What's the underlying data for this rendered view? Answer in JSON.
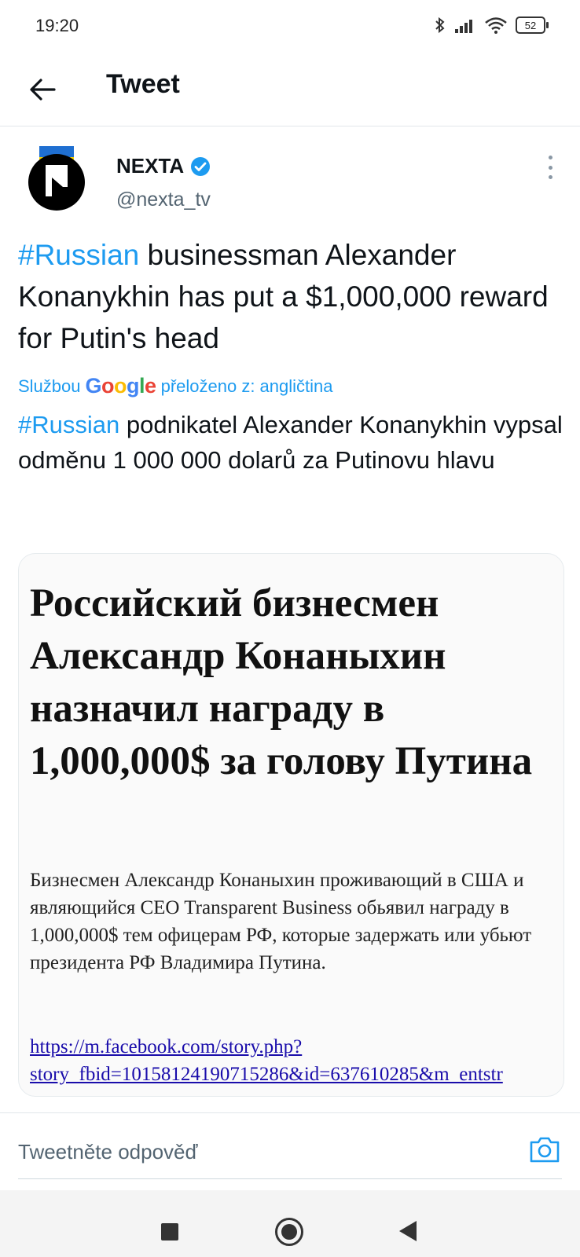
{
  "status_bar": {
    "time": "19:20",
    "battery": "52",
    "icons": [
      "bluetooth-icon",
      "signal-icon",
      "wifi-icon",
      "battery-icon"
    ]
  },
  "header": {
    "title": "Tweet",
    "back_icon": "arrow-left-icon"
  },
  "tweet": {
    "author_name": "NEXTA",
    "author_handle": "@nexta_tv",
    "verified": true,
    "hashtag": "#Russian",
    "text_rest": " businessman Alexander Konanykhin has put a $1,000,000 reward for Putin's head",
    "translated_prefix": "Službou",
    "translated_logo": "Google",
    "translated_suffix": "přeloženo z: angličtina",
    "translation_hashtag": "#Russian",
    "translation_rest": " podnikatel Alexander Konanykhin vypsal odměnu 1 000 000 dolarů za Putinovu hlavu"
  },
  "media": {
    "headline": "Российский бизнесмен Александр Конаныхин назначил награду в 1,000,000$ за голову Путина",
    "body": "Бизнесмен Александр Конаныхин проживающий в США и являющийся CEO Transparent Business обьявил награду в 1,000,000$ тем офицерам РФ, которые задержать или убьют президента РФ Владимира Путина.",
    "link_line1": "https://m.facebook.com/story.php?",
    "link_line2": "story_fbid=10158124190715286&id=637610285&m_entstr"
  },
  "reply": {
    "placeholder": "Tweetněte odpověď",
    "camera_icon": "camera-icon"
  },
  "colors": {
    "accent": "#1d9bf0",
    "text": "#0f1419",
    "muted": "#536471"
  }
}
